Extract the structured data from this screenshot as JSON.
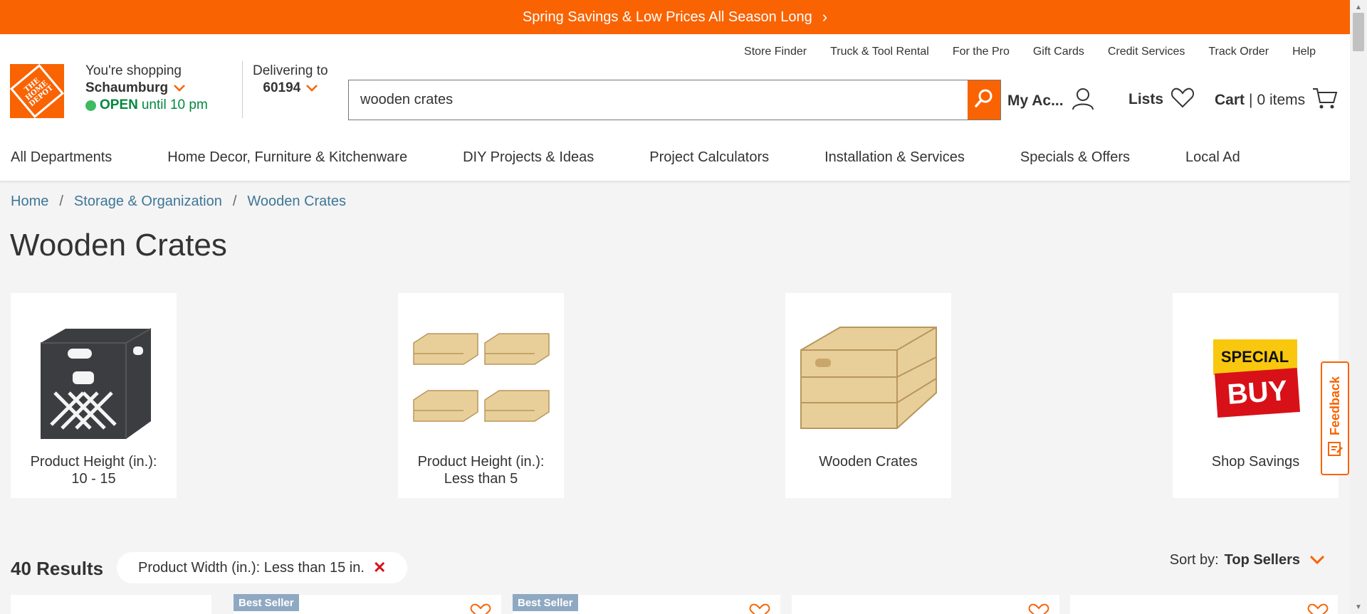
{
  "promo": {
    "text": "Spring Savings & Low Prices All Season Long"
  },
  "utility_links": [
    "Store Finder",
    "Truck & Tool Rental",
    "For the Pro",
    "Gift Cards",
    "Credit Services",
    "Track Order",
    "Help"
  ],
  "store": {
    "label": "You're shopping",
    "name": "Schaumburg",
    "status": "OPEN",
    "hours": "until 10 pm"
  },
  "delivery": {
    "label": "Delivering to",
    "zip": "60194"
  },
  "search": {
    "value": "wooden crates"
  },
  "account": {
    "my_account": "My Ac...",
    "lists": "Lists",
    "cart": "Cart",
    "cart_separator": "|",
    "cart_count": "0 items"
  },
  "nav": [
    "All Departments",
    "Home Decor, Furniture & Kitchenware",
    "DIY Projects & Ideas",
    "Project Calculators",
    "Installation & Services",
    "Specials & Offers",
    "Local Ad"
  ],
  "breadcrumb": [
    "Home",
    "Storage & Organization",
    "Wooden Crates"
  ],
  "page_title": "Wooden Crates",
  "categories": [
    {
      "line1": "Product Height (in.):",
      "line2": "10 - 15"
    },
    {
      "line1": "Product Height (in.):",
      "line2": "Less than 5"
    },
    {
      "line1": "Wooden Crates",
      "line2": ""
    },
    {
      "line1": "Shop Savings",
      "line2": ""
    }
  ],
  "special_buy": {
    "line1": "SPECIAL",
    "line2": "BUY"
  },
  "results": {
    "count": "40 Results"
  },
  "filter_chip": {
    "label": "Product Width (in.): Less than 15 in."
  },
  "sort": {
    "label": "Sort by:",
    "value": "Top Sellers"
  },
  "badges": [
    "Best Seller",
    "Best Seller"
  ],
  "feedback": {
    "label": "Feedback"
  },
  "colors": {
    "brand": "#f96302",
    "link": "#3e7697",
    "open": "#00883e"
  }
}
